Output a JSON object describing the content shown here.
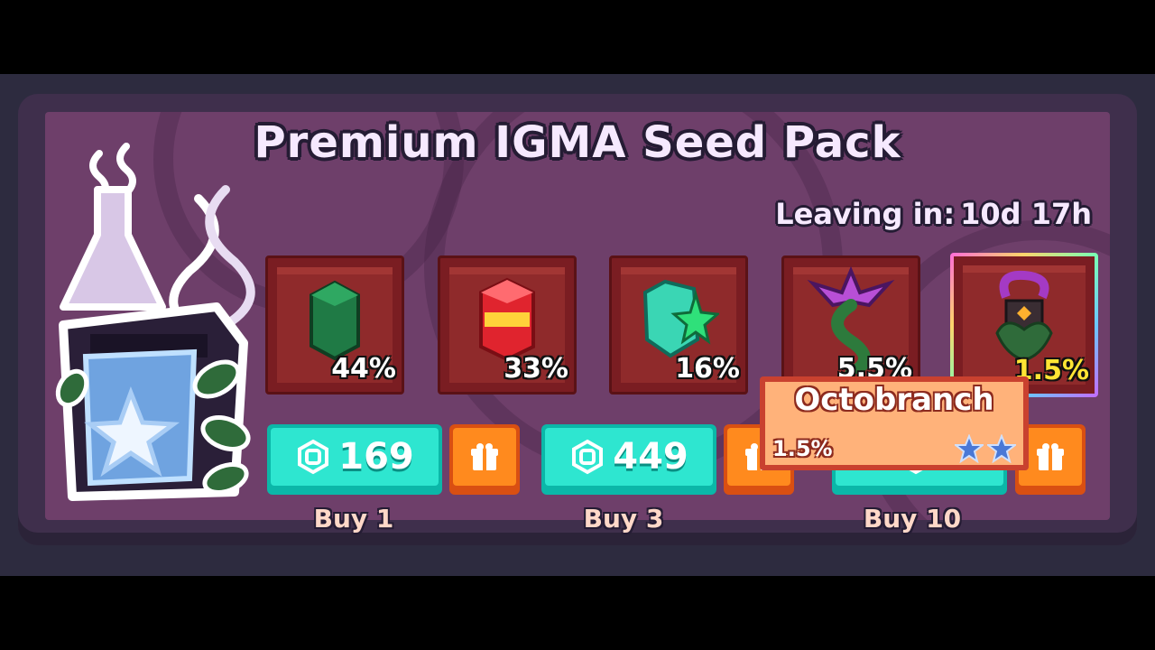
{
  "title": "Premium IGMA Seed Pack",
  "leaving": {
    "label": "Leaving in:",
    "value": "10d 17h"
  },
  "drops": [
    {
      "name": "green-seed",
      "percent": "44%"
    },
    {
      "name": "red-lantern-seed",
      "percent": "33%"
    },
    {
      "name": "star-crystal-seed",
      "percent": "16%"
    },
    {
      "name": "purple-flower-plant",
      "percent": "5.5%"
    },
    {
      "name": "octobranch",
      "percent": "1.5%"
    }
  ],
  "buttons": [
    {
      "price": "169",
      "label": "Buy 1",
      "icon": "robux-icon"
    },
    {
      "price": "449",
      "label": "Buy 3",
      "icon": "robux-icon"
    },
    {
      "price": "",
      "label": "Buy 10",
      "icon": "robux-icon"
    }
  ],
  "tooltip": {
    "name": "Octobranch",
    "percent": "1.5%",
    "stars": 2
  },
  "colors": {
    "accent_teal": "#2ee6d0",
    "gift_orange": "#ff8a1e",
    "panel_purple": "#6e3f6a",
    "slot_red": "#7a1d22"
  }
}
